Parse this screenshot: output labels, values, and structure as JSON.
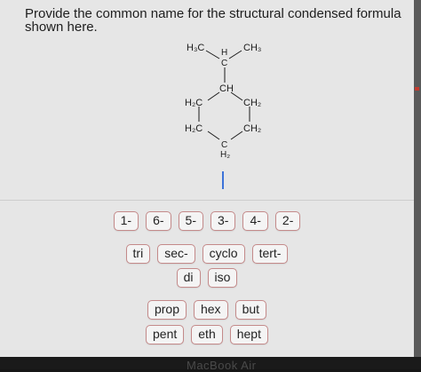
{
  "question": {
    "text": "Provide the common name for the structural condensed formula shown here."
  },
  "structure": {
    "top_left": "H₃C",
    "top_h": "H",
    "top_c": "C",
    "top_right": "CH₃",
    "ring_ch": "CH",
    "ring_left1": "H₂C",
    "ring_right1": "CH₂",
    "ring_left2": "H₂C",
    "ring_right2": "CH₂",
    "ring_bottom_c": "C",
    "ring_bottom_h": "H₂"
  },
  "answer_box": {
    "value": ""
  },
  "bank": {
    "row1": [
      "1-",
      "6-",
      "5-",
      "3-",
      "4-",
      "2-"
    ],
    "row2": [
      "tri",
      "sec-",
      "cyclo",
      "tert-"
    ],
    "row3": [
      "di",
      "iso"
    ],
    "row4": [
      "prop",
      "hex",
      "but"
    ],
    "row5": [
      "pent",
      "eth",
      "hept"
    ]
  },
  "bezel": {
    "label": "MacBook Air"
  }
}
